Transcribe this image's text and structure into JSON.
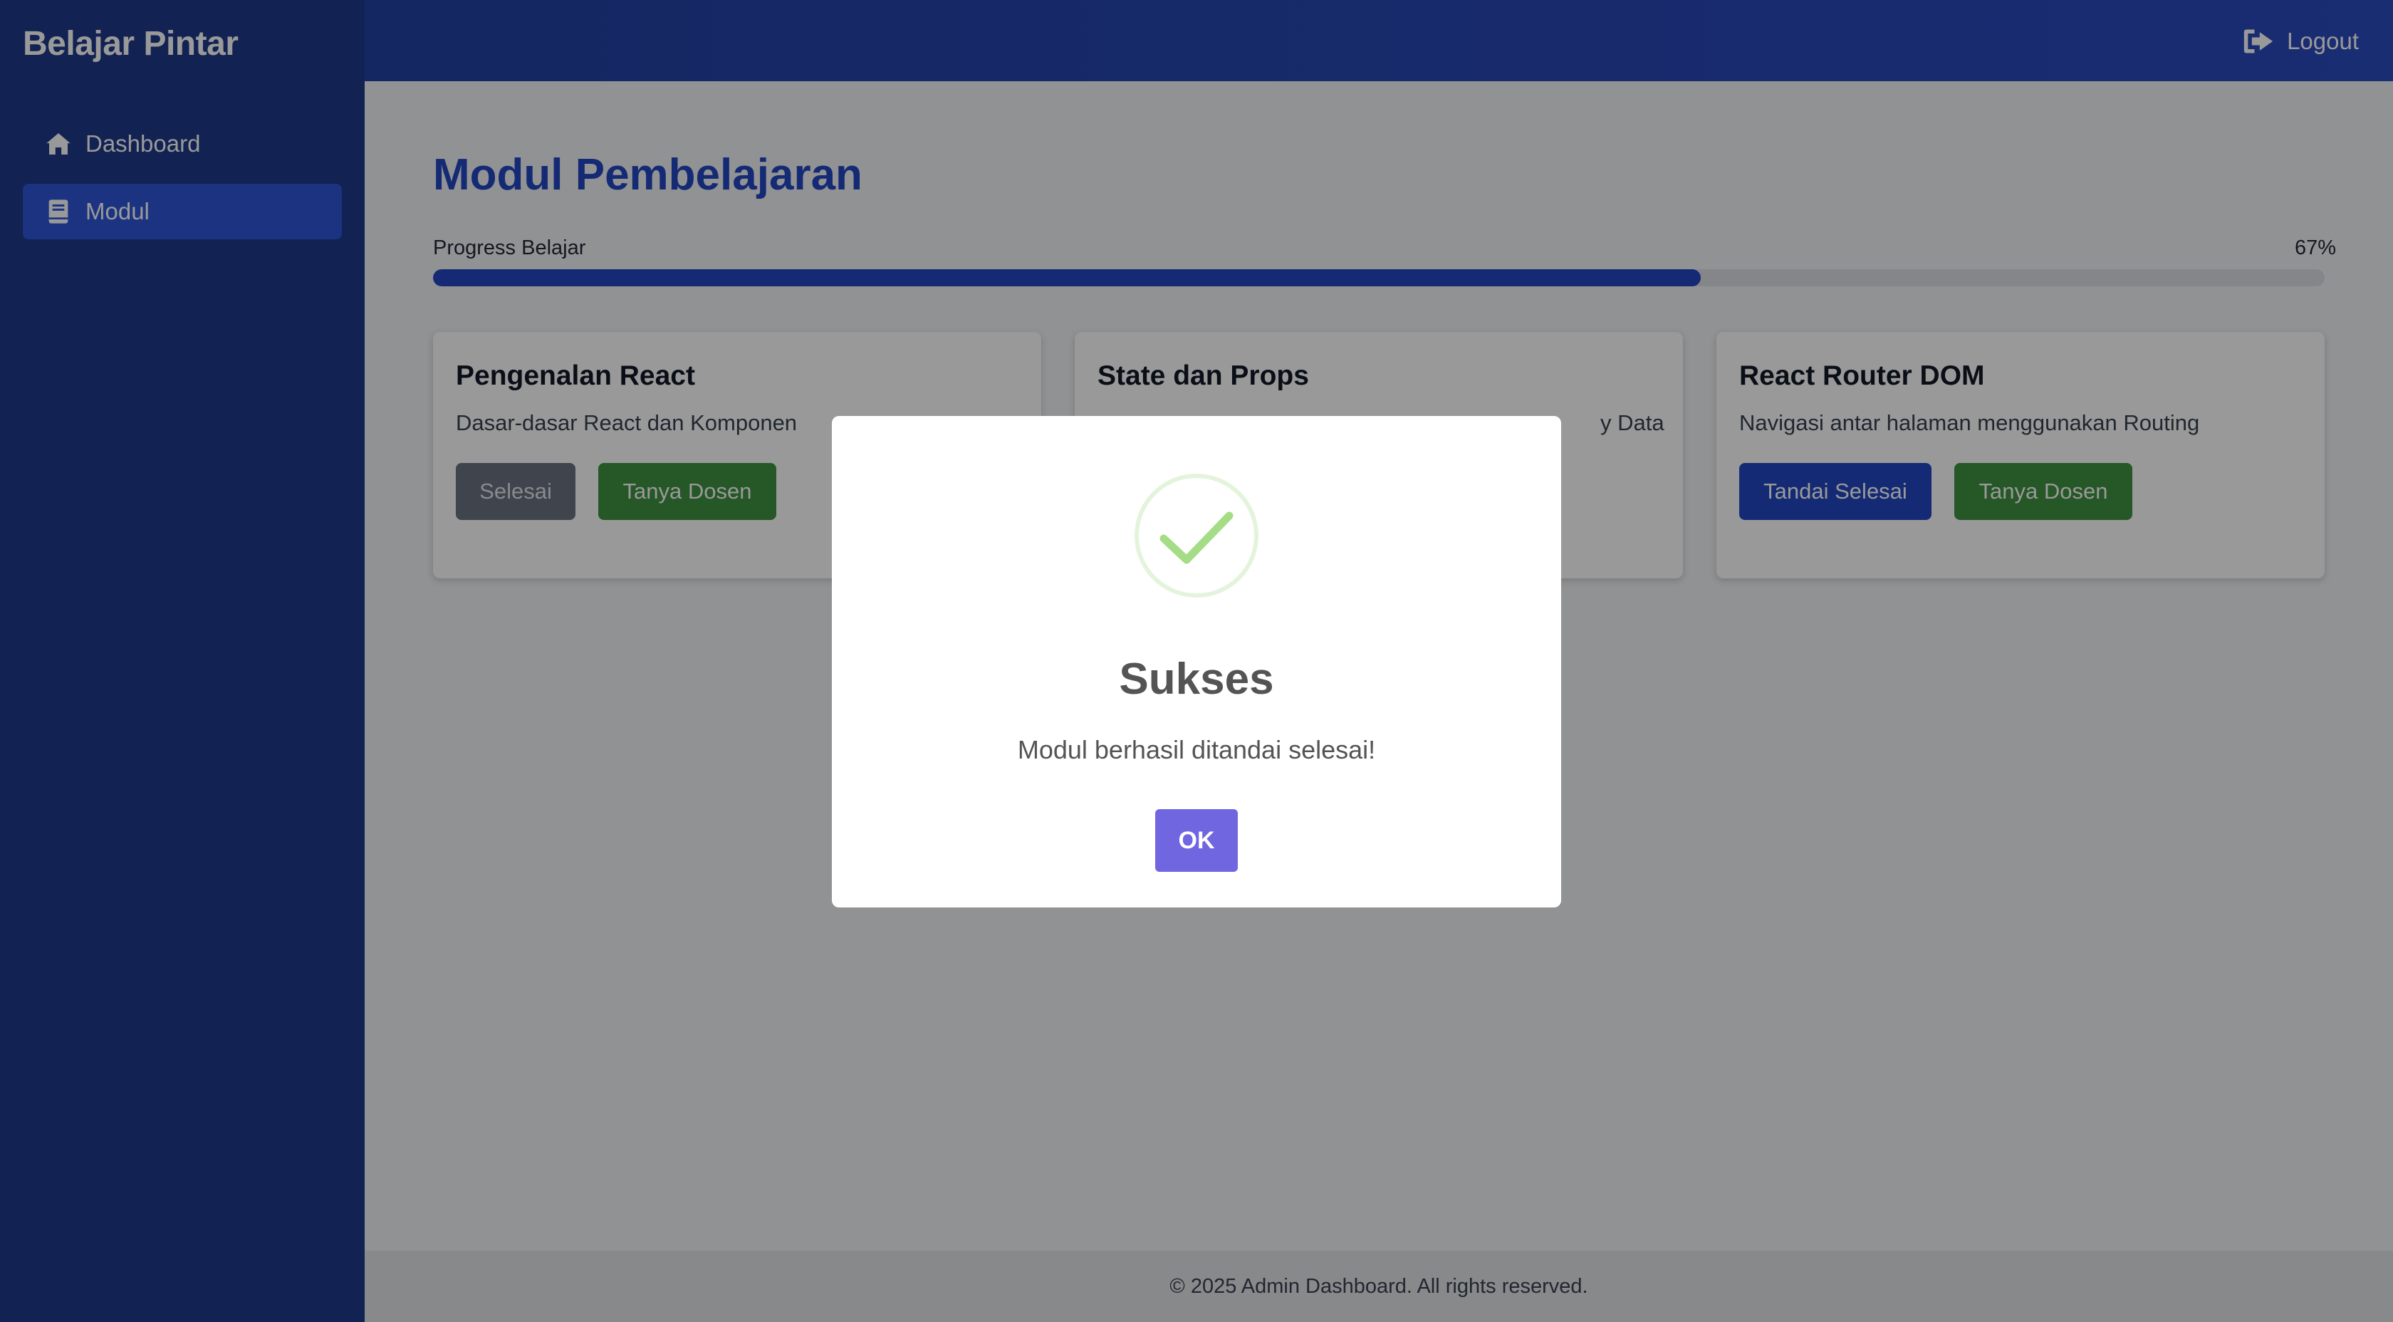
{
  "sidebar": {
    "brand": "Belajar Pintar",
    "items": [
      {
        "label": "Dashboard",
        "icon": "home-icon",
        "active": false
      },
      {
        "label": "Modul",
        "icon": "book-icon",
        "active": true
      }
    ]
  },
  "header": {
    "logout_label": "Logout",
    "logout_icon": "logout-icon"
  },
  "main": {
    "title": "Modul Pembelajaran",
    "progress": {
      "label": "Progress Belajar",
      "percent_text": "67%",
      "value": 0.67
    },
    "modules": [
      {
        "title": "Pengenalan React",
        "description": "Dasar-dasar React dan Komponen",
        "primary_label": "Selesai",
        "secondary_label": "Tanya Dosen"
      },
      {
        "title": "State dan Props",
        "description": "y Data"
      },
      {
        "title": "React Router DOM",
        "description": "Navigasi antar halaman menggunakan Routing",
        "primary_label": "Tandai Selesai",
        "secondary_label": "Tanya Dosen"
      }
    ]
  },
  "footer": {
    "text": "© 2025 Admin Dashboard. All rights reserved."
  },
  "modal": {
    "icon": "checkmark-icon",
    "title": "Sukses",
    "text": "Modul berhasil ditandai selesai!",
    "ok_label": "OK"
  },
  "colors": {
    "sidebar_bg": "#1e3a8a",
    "accent": "#2446c2",
    "success_green": "#3f9142",
    "disabled_gray": "#6b7280",
    "modal_button": "#7066e0",
    "check_stroke": "#a5dc86"
  }
}
